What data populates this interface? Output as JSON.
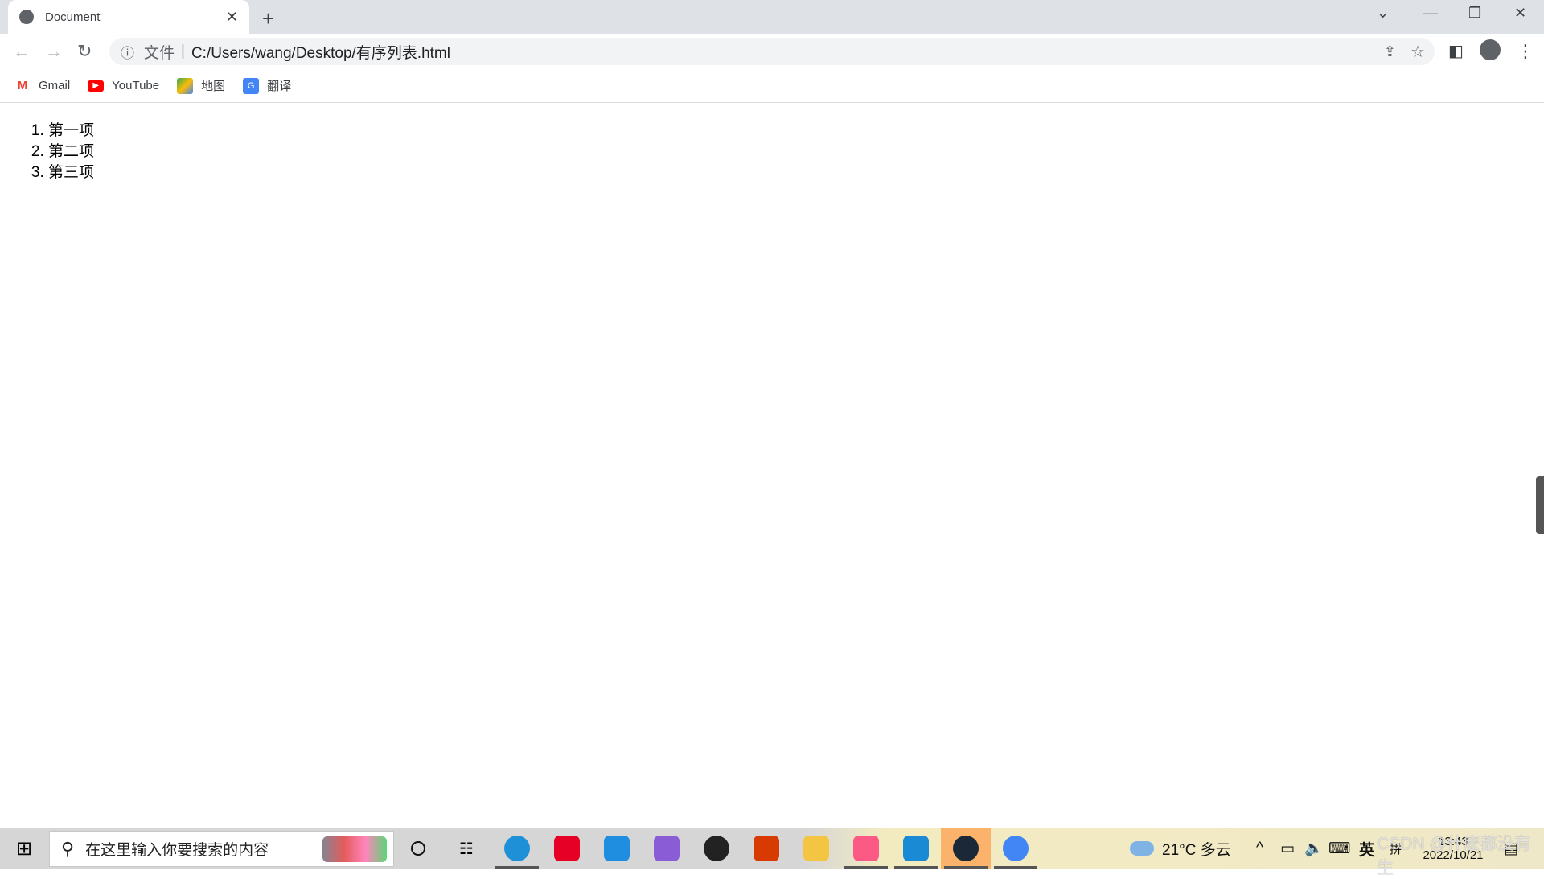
{
  "browser": {
    "tab_title": "Document",
    "address_label": "文件",
    "url": "C:/Users/wang/Desktop/有序列表.html"
  },
  "bookmarks": [
    {
      "label": "Gmail",
      "icon": "gmail-icon",
      "color": "#ea4335"
    },
    {
      "label": "YouTube",
      "icon": "youtube-icon",
      "color": "#ff0000"
    },
    {
      "label": "地图",
      "icon": "maps-icon",
      "color": "#34a853"
    },
    {
      "label": "翻译",
      "icon": "translate-icon",
      "color": "#4285f4"
    }
  ],
  "page": {
    "list": [
      "第一项",
      "第二项",
      "第三项"
    ]
  },
  "taskbar": {
    "search_placeholder": "在这里输入你要搜索的内容",
    "apps": [
      {
        "name": "edge",
        "color": "#1e90d8",
        "active": true
      },
      {
        "name": "netease-music",
        "color": "#e60026",
        "active": false
      },
      {
        "name": "mail",
        "color": "#1f8de0",
        "active": false
      },
      {
        "name": "visual-studio",
        "color": "#8a5cd6",
        "active": false
      },
      {
        "name": "dell",
        "color": "#222222",
        "active": false
      },
      {
        "name": "office",
        "color": "#d83b01",
        "active": false
      },
      {
        "name": "file-explorer",
        "color": "#f4c542",
        "active": false
      },
      {
        "name": "bilibili",
        "color": "#fb5a85",
        "active": true
      },
      {
        "name": "vscode",
        "color": "#1a8ad4",
        "active": true
      },
      {
        "name": "steam",
        "color": "#1b2838",
        "active": true
      },
      {
        "name": "chrome",
        "color": "#4285f4",
        "active": true
      }
    ],
    "weather": "21°C 多云",
    "ime_lang": "英",
    "ime_mode": "拼",
    "time": "13:43",
    "date": "2022/10/21"
  },
  "watermark": "CSDN @什麽都没有生"
}
